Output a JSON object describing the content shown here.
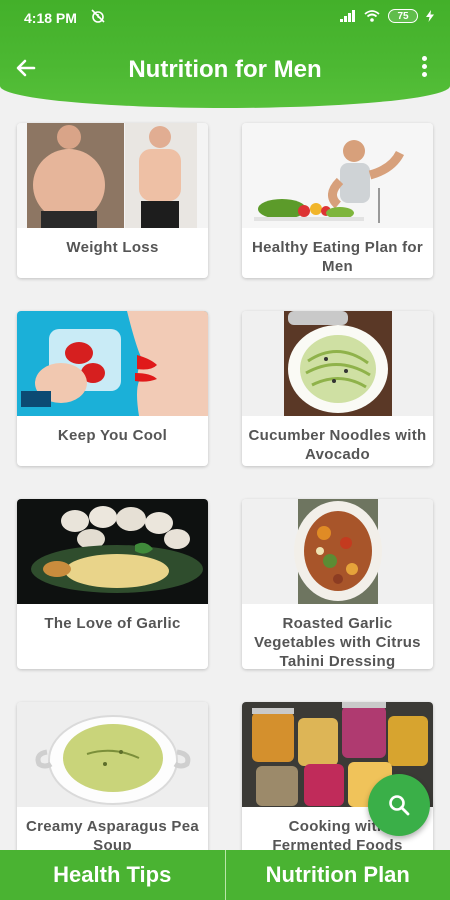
{
  "status_bar": {
    "time": "4:18 PM",
    "battery": "75"
  },
  "header": {
    "title": "Nutrition for Men"
  },
  "cards": [
    {
      "label": "Weight Loss"
    },
    {
      "label": "Healthy Eating Plan for Men"
    },
    {
      "label": "Keep You Cool"
    },
    {
      "label": "Cucumber Noodles with Avocado"
    },
    {
      "label": "The Love of Garlic"
    },
    {
      "label": "Roasted Garlic Vegetables with Citrus Tahini Dressing"
    },
    {
      "label": "Creamy Asparagus Pea Soup"
    },
    {
      "label": "Cooking with Fermented Foods"
    }
  ],
  "bottom_nav": {
    "left": "Health Tips",
    "right": "Nutrition Plan"
  },
  "icons": {
    "back": "arrow-left-icon",
    "menu": "more-vert-icon",
    "search": "search-icon",
    "alarm_off": "alarm-off-icon",
    "signal": "signal-icon",
    "wifi": "wifi-icon",
    "charging": "bolt-icon"
  },
  "colors": {
    "primary": "#4ab332",
    "fab": "#3aaf48",
    "text": "#555555"
  }
}
